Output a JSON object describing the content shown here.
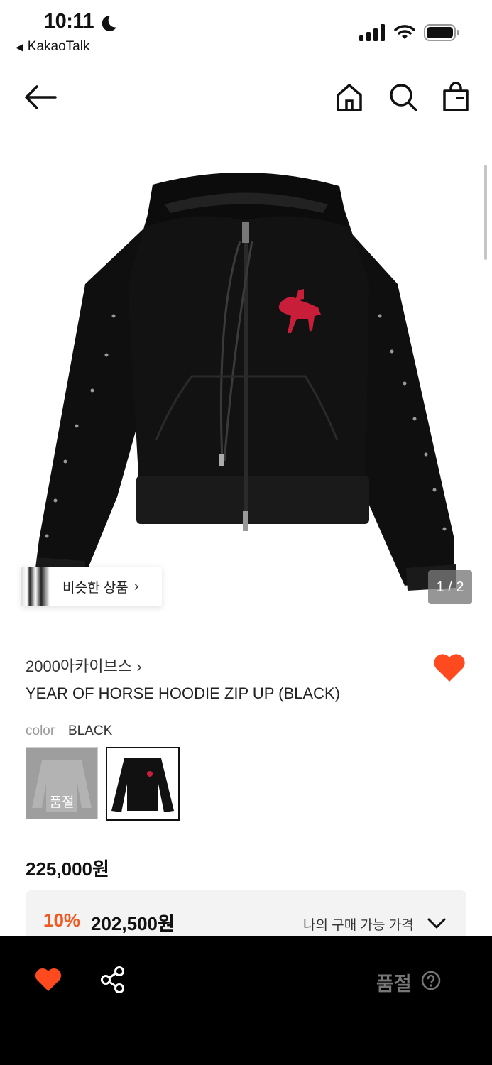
{
  "status_bar": {
    "time": "10:11",
    "back_app": "KakaoTalk"
  },
  "image_gallery": {
    "similar_label": "비슷한 상품",
    "counter": "1 / 2"
  },
  "product": {
    "brand": "2000아카이브스",
    "name": "YEAR OF HORSE HOODIE ZIP UP (BLACK)",
    "color_label": "color",
    "color_value": "BLACK",
    "swatch_soldout": "품절",
    "price": "225,000원",
    "discount_rate": "10%",
    "discount_price": "202,500원",
    "my_price_label": "나의 구매 가능 가격"
  },
  "bottom_bar": {
    "soldout_label": "품절"
  },
  "colors": {
    "accent_red": "#f05a22",
    "heart_red": "#ff4a1f"
  },
  "icons": [
    "moon-icon",
    "cellular-signal-icon",
    "wifi-icon",
    "battery-icon",
    "back-arrow-icon",
    "home-icon",
    "search-icon",
    "shopping-bag-icon",
    "chevron-right-icon",
    "heart-icon",
    "chevron-down-icon",
    "share-icon",
    "help-icon"
  ]
}
